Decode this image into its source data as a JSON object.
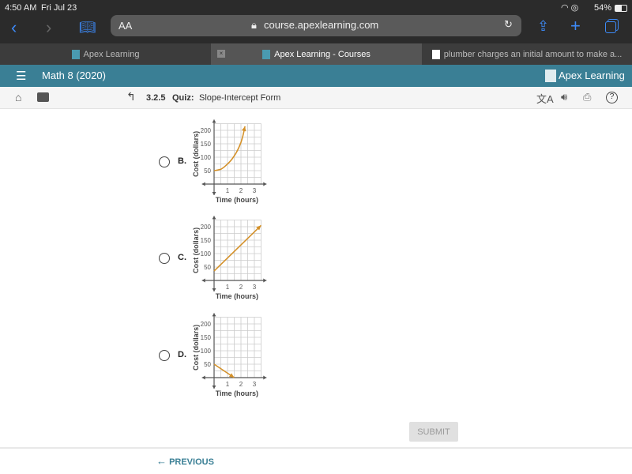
{
  "status_bar": {
    "time": "4:50 AM",
    "date": "Fri Jul 23",
    "battery": "54%"
  },
  "browser": {
    "text_size_label": "AA",
    "url": "course.apexlearning.com",
    "tabs": [
      {
        "label": "Apex Learning",
        "active": false
      },
      {
        "label": "Apex Learning - Courses",
        "active": true
      },
      {
        "label": "plumber charges an initial amount to make a...",
        "active": false
      }
    ]
  },
  "header": {
    "course_title": "Math 8 (2020)",
    "logo_text": "Apex Learning",
    "accent_color": "#3a7f95"
  },
  "subheader": {
    "lesson_number": "3.2.5",
    "lesson_type": "Quiz:",
    "lesson_title": "Slope-Intercept Form"
  },
  "graph_common": {
    "x_label": "Time (hours)",
    "y_label": "Cost (dollars)",
    "x_ticks": [
      "1",
      "2",
      "3"
    ],
    "y_ticks": [
      "50",
      "100",
      "150",
      "200"
    ],
    "line_color": "#d4912a"
  },
  "options": [
    {
      "letter": "B.",
      "chart_data": {
        "type": "line",
        "xlabel": "Time (hours)",
        "ylabel": "Cost (dollars)",
        "xlim": [
          0,
          3.5
        ],
        "ylim": [
          0,
          225
        ],
        "points": [
          [
            0,
            50
          ],
          [
            0.5,
            55
          ],
          [
            1,
            75
          ],
          [
            1.5,
            105
          ],
          [
            2,
            155
          ],
          [
            2.3,
            215
          ]
        ]
      }
    },
    {
      "letter": "C.",
      "chart_data": {
        "type": "line",
        "xlabel": "Time (hours)",
        "ylabel": "Cost (dollars)",
        "xlim": [
          0,
          3.5
        ],
        "ylim": [
          0,
          225
        ],
        "points": [
          [
            0,
            35
          ],
          [
            3.5,
            205
          ]
        ]
      }
    },
    {
      "letter": "D.",
      "chart_data": {
        "type": "line",
        "xlabel": "Time (hours)",
        "ylabel": "Cost (dollars)",
        "xlim": [
          0,
          3.5
        ],
        "ylim": [
          0,
          225
        ],
        "points": [
          [
            0,
            50
          ],
          [
            1.5,
            0
          ]
        ]
      }
    }
  ],
  "footer": {
    "submit_label": "SUBMIT",
    "previous_label": "PREVIOUS"
  }
}
